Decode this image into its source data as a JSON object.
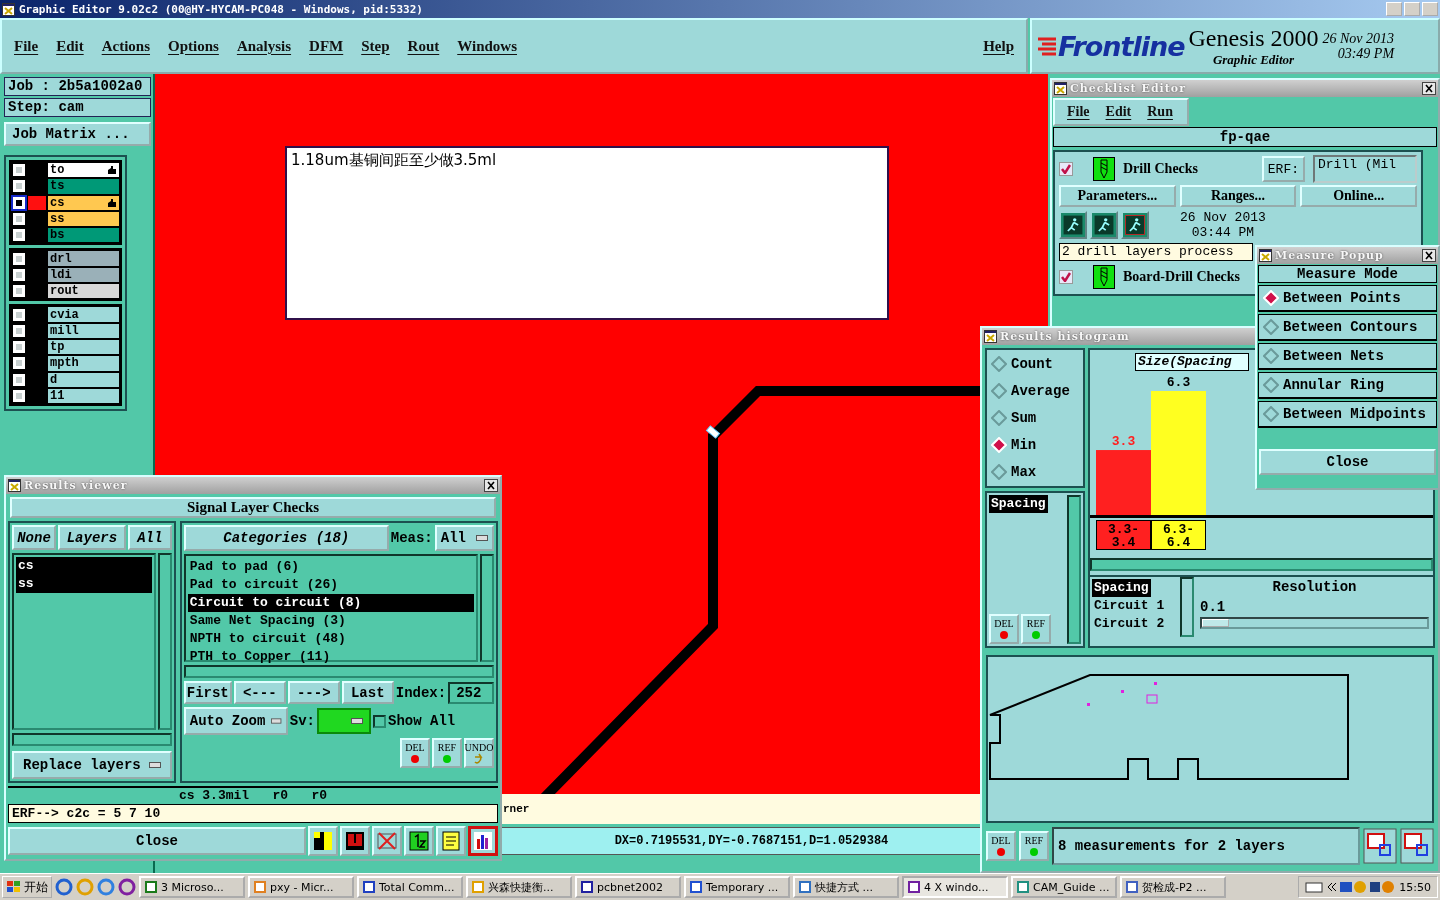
{
  "window": {
    "title": "Graphic Editor 9.02c2 (00@HY-HYCAM-PC048 - Windows, pid:5332)"
  },
  "menu": [
    "File",
    "Edit",
    "Actions",
    "Options",
    "Analysis",
    "DFM",
    "Step",
    "Rout",
    "Windows"
  ],
  "help": "Help",
  "brand": {
    "logo": "Frontline",
    "product": "Genesis 2000",
    "subtitle": "Graphic Editor",
    "date": "26 Nov 2013",
    "time": "03:49 PM"
  },
  "job": {
    "job": "Job : 2b5a1002a0",
    "step": "Step: cam",
    "matrix_button": "Job Matrix ..."
  },
  "layer_groups": [
    [
      {
        "name": "to",
        "color": "#ffffff",
        "selected": false,
        "affected": true
      },
      {
        "name": "ts",
        "color": "#009977",
        "selected": false,
        "affected": false
      },
      {
        "name": "cs",
        "color": "#ffc850",
        "selected": true,
        "affected": true
      },
      {
        "name": "ss",
        "color": "#ffc850",
        "selected": false,
        "affected": false
      },
      {
        "name": "bs",
        "color": "#009977",
        "selected": false,
        "affected": false
      }
    ],
    [
      {
        "name": "drl",
        "color": "#9ab0b8",
        "selected": false,
        "affected": false
      },
      {
        "name": "ldi",
        "color": "#9ab0b8",
        "selected": false,
        "affected": false
      },
      {
        "name": "rout",
        "color": "#d8d8d8",
        "selected": false,
        "affected": false
      }
    ],
    [
      {
        "name": "cvia",
        "color": "#9ed9d9",
        "selected": false,
        "affected": false
      },
      {
        "name": "mill",
        "color": "#9ed9d9",
        "selected": false,
        "affected": false
      },
      {
        "name": "tp",
        "color": "#9ed9d9",
        "selected": false,
        "affected": false
      },
      {
        "name": "mpth",
        "color": "#9ed9d9",
        "selected": false,
        "affected": false
      },
      {
        "name": "d",
        "color": "#9ed9d9",
        "selected": false,
        "affected": false
      },
      {
        "name": "11",
        "color": "#9ed9d9",
        "selected": false,
        "affected": false
      }
    ]
  ],
  "canvas": {
    "note": "1.18um基铜间距至少做3.5ml",
    "prompt": "rner",
    "coordinates": "DX=0.7195531,DY=-0.7687151,D=1.0529384"
  },
  "results_viewer": {
    "title": "Results viewer",
    "header": "Signal Layer Checks",
    "layer_buttons": [
      "None",
      "Layers",
      "All"
    ],
    "layers": [
      {
        "name": "cs",
        "selected": true
      },
      {
        "name": "ss",
        "selected": true
      }
    ],
    "categories_button": "Categories (18)",
    "meas_label": "Meas:",
    "meas_value": "All",
    "categories": [
      {
        "label": "Pad to pad (6)",
        "selected": false
      },
      {
        "label": "Pad to circuit (26)",
        "selected": false
      },
      {
        "label": "Circuit to circuit (8)",
        "selected": true
      },
      {
        "label": "Same Net Spacing (3)",
        "selected": false
      },
      {
        "label": "NPTH to circuit (48)",
        "selected": false
      },
      {
        "label": "PTH to Copper (11)",
        "selected": false
      }
    ],
    "nav": [
      "First",
      "<---",
      "--->",
      "Last"
    ],
    "index_label": "Index:",
    "index_value": "252",
    "zoom_mode": "Auto Zoom",
    "sv_label": "Sv:",
    "show_all": {
      "label": "Show All",
      "checked": false
    },
    "action_buttons": [
      "DEL",
      "REF",
      "UNDO"
    ],
    "replace": "Replace layers",
    "info": "cs 3.3mil   r0   r0",
    "erf": "ERF--> c2c = 5 7 10",
    "close": "Close",
    "tools": [
      {
        "selected": false
      },
      {
        "selected": false
      },
      {
        "selected": false
      },
      {
        "selected": false
      },
      {
        "selected": false
      },
      {
        "selected": true
      }
    ]
  },
  "checklist_editor": {
    "title": "Checklist Editor",
    "menu": [
      "File",
      "Edit",
      "Run"
    ],
    "name": "fp-qae",
    "checks": [
      {
        "name": "Drill Checks",
        "checked": true,
        "erf_label": "ERF:",
        "erf_value": "Drill (Mil",
        "actions": [
          "Parameters...",
          "Ranges...",
          "Online..."
        ],
        "run_date": "26 Nov 2013",
        "run_time": "03:44 PM",
        "message": "2 drill layers process"
      },
      {
        "name": "Board-Drill Checks",
        "checked": true
      }
    ]
  },
  "results_histogram": {
    "title": "Results histogram",
    "stats": [
      {
        "label": "Count",
        "selected": false
      },
      {
        "label": "Average",
        "selected": false
      },
      {
        "label": "Sum",
        "selected": false
      },
      {
        "label": "Min",
        "selected": true
      },
      {
        "label": "Max",
        "selected": false
      }
    ],
    "fields": [
      {
        "label": "Spacing",
        "selected": true
      }
    ],
    "side_buttons": [
      "DEL",
      "REF"
    ],
    "chart_data": {
      "type": "bar",
      "title": "Size(Spacing",
      "categories": [
        "3.3-3.4",
        "6.3-6.4"
      ],
      "stacked": true,
      "data_labels": true,
      "series": [
        {
          "color": "#ff2020",
          "values": [
            3.3,
            null
          ]
        },
        {
          "color": "#ffff20",
          "values": [
            null,
            6.3
          ]
        }
      ]
    },
    "legend": [
      {
        "label": "Spacing",
        "selected": true
      },
      {
        "label": "Circuit 1",
        "selected": false
      },
      {
        "label": "Circuit 2",
        "selected": false
      }
    ],
    "resolution_label": "Resolution",
    "resolution_value": "0.1",
    "resolution": {
      "level": 0.12
    },
    "map_buttons": [
      "DEL",
      "REF"
    ],
    "summary": "8 measurements for 2 layers"
  },
  "measure_popup": {
    "title": "Measure Popup",
    "header": "Measure Mode",
    "modes": [
      {
        "label": "Between Points",
        "selected": true
      },
      {
        "label": "Between Contours",
        "selected": false
      },
      {
        "label": "Between Nets",
        "selected": false
      },
      {
        "label": "Annular Ring",
        "selected": false
      },
      {
        "label": "Between Midpoints",
        "selected": false
      }
    ],
    "close": "Close"
  },
  "taskbar": {
    "start": "开始",
    "tasks": [
      {
        "label": "3 Microso...",
        "selected": false
      },
      {
        "label": "pxy - Micr...",
        "selected": false
      },
      {
        "label": "Total Comm...",
        "selected": false
      },
      {
        "label": "兴森快捷衡...",
        "selected": false
      },
      {
        "label": "pcbnet2002",
        "selected": false
      },
      {
        "label": "Temporary ...",
        "selected": false
      },
      {
        "label": "快捷方式 ...",
        "selected": false
      },
      {
        "label": "4 X windo...",
        "selected": true
      },
      {
        "label": "CAM_Guide ...",
        "selected": false
      },
      {
        "label": "贺检成-P2 ...",
        "selected": false
      }
    ],
    "clock": "15:50"
  }
}
